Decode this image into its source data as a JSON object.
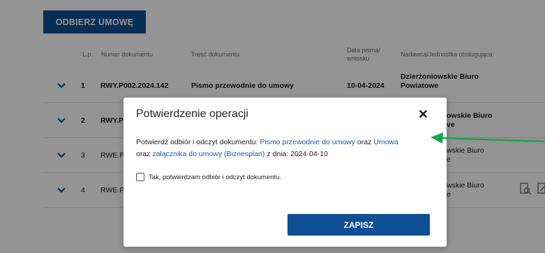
{
  "page": {
    "receive_button": "ODBIERZ UMOWĘ",
    "table": {
      "headers": {
        "lp": "L.p.",
        "number": "Numer dokumentu",
        "content": "Treść dokumentu",
        "date": "Data pisma/\nwniosku",
        "sender": "Nadawca/Jednostka obsługująca"
      },
      "rows": [
        {
          "lp": "1",
          "number": "RWY.P002.2024.142",
          "content": "Pismo przewodnie do umowy",
          "date": "10-04-2024",
          "sender": "Dzierżoniowskie Biuro\nPowiatowe"
        },
        {
          "lp": "2",
          "number": "RWY.P(",
          "content": "",
          "date": "",
          "sender": "owskie Biuro\nve"
        },
        {
          "lp": "3",
          "number": "RWE.P0",
          "content": "",
          "date": "",
          "sender": "wskie Biuro\ne"
        },
        {
          "lp": "4",
          "number": "RWE.P0",
          "content": "",
          "date": "",
          "sender": "wskie Biuro\ne"
        }
      ]
    },
    "pager_next": ">"
  },
  "modal": {
    "title": "Potwierdzenie operacji",
    "close_glyph": "✕",
    "text_prefix": "Potwierdź odbiór i odczyt dokumentu: ",
    "link1": "Pismo przewodnie do umowy",
    "text_and": " oraz ",
    "link2": "Umowa",
    "text_and2": "oraz ",
    "link3": "załącznika do umowy (Biznesplan)",
    "text_suffix": " z dnia: 2024-04-10",
    "checkbox_label": "Tak, potwierdzam odbiór i odczyt dokumentu.",
    "save_button": "ZAPISZ"
  },
  "colors": {
    "brand": "#0f4f95",
    "link": "#1a5aa6",
    "annotation_arrow": "#1aa34a"
  },
  "icons": {
    "row_toggle": "chevron-down-icon",
    "close": "close-icon",
    "row_action_1": "document-search-icon",
    "row_action_2": "document-sign-icon",
    "annotation": "arrow-left-icon"
  }
}
